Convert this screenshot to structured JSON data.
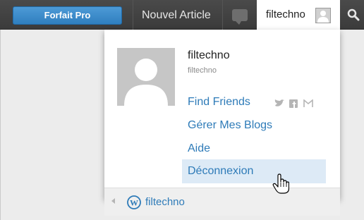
{
  "topbar": {
    "pro_label": "Forfait Pro",
    "new_article_label": "Nouvel Article",
    "user_tab_label": "filtechno"
  },
  "dropdown": {
    "username": "filtechno",
    "handle": "filtechno",
    "items": [
      {
        "label": "Find Friends"
      },
      {
        "label": "Gérer Mes Blogs"
      },
      {
        "label": "Aide"
      },
      {
        "label": "Déconnexion",
        "hovered": true
      }
    ],
    "social_icons": [
      "twitter-icon",
      "facebook-icon",
      "mail-icon"
    ],
    "footer_label": "filtechno"
  },
  "colors": {
    "topbar": "#3b3b3b",
    "pro_button": "#3a8bcb",
    "link": "#2e7bb8",
    "hover_row": "#ddeaf6"
  }
}
